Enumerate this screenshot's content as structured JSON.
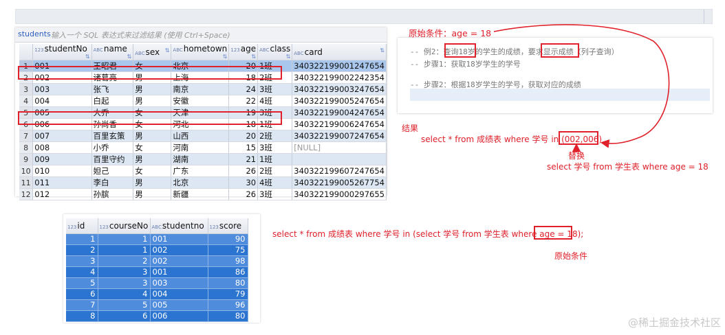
{
  "students_panel": {
    "tab": "students",
    "filter_placeholder": "输入一个 SQL 表达式来过滤结果 (使用 Ctrl+Space)",
    "columns": [
      "studentNo",
      "name",
      "sex",
      "hometown",
      "age",
      "class",
      "card"
    ],
    "rows": [
      [
        "1",
        "001",
        "王昭君",
        "女",
        "北京",
        "20",
        "1班",
        "340322199001247654"
      ],
      [
        "2",
        "002",
        "诸葛亮",
        "男",
        "上海",
        "18",
        "2班",
        "340322199002242354"
      ],
      [
        "3",
        "003",
        "张飞",
        "男",
        "南京",
        "24",
        "3班",
        "340322199003247654"
      ],
      [
        "4",
        "004",
        "白起",
        "男",
        "安徽",
        "22",
        "4班",
        "340322199005247654"
      ],
      [
        "5",
        "005",
        "大乔",
        "女",
        "天津",
        "19",
        "3班",
        "340322199004247654"
      ],
      [
        "6",
        "006",
        "孙尚香",
        "女",
        "河北",
        "18",
        "1班",
        "340322199006247654"
      ],
      [
        "7",
        "007",
        "百里玄策",
        "男",
        "山西",
        "20",
        "2班",
        "340322199007247654"
      ],
      [
        "8",
        "008",
        "小乔",
        "女",
        "河南",
        "15",
        "3班",
        "[NULL]"
      ],
      [
        "9",
        "009",
        "百里守约",
        "男",
        "湖南",
        "21",
        "1班",
        ""
      ],
      [
        "10",
        "010",
        "妲己",
        "女",
        "广东",
        "26",
        "2班",
        "340322199607247654"
      ],
      [
        "11",
        "011",
        "李白",
        "男",
        "北京",
        "30",
        "4班",
        "340322199005267754"
      ],
      [
        "12",
        "012",
        "孙膑",
        "男",
        "新疆",
        "26",
        "3班",
        "340322199000297655"
      ]
    ]
  },
  "comment_panel": {
    "lines": [
      "-- 例2：查询18岁的学生的成绩，要求显示成绩（列子查询）",
      "-- 步骤1：获取18岁学生的学号",
      "-- 步骤2：根据18岁学生的学号，获取对应的成绩"
    ]
  },
  "annotations": {
    "original_condition_top": "原始条件：age = 18",
    "result_label": "结果",
    "result_sql": "select * from 成绩表 where 学号 in (002,006)",
    "replace_label": "替换",
    "subquery_sql": "select 学号 from 学生表 where age = 18",
    "full_sql": "select * from 成绩表 where 学号 in (select 学号 from 学生表 where age = 18);",
    "original_condition_bottom": "原始条件"
  },
  "scores_panel": {
    "columns": [
      "id",
      "courseNo",
      "studentno",
      "score"
    ],
    "rows": [
      [
        "1",
        "1",
        "001",
        "90"
      ],
      [
        "2",
        "1",
        "002",
        "75"
      ],
      [
        "3",
        "2",
        "002",
        "98"
      ],
      [
        "4",
        "3",
        "001",
        "86"
      ],
      [
        "5",
        "3",
        "003",
        "80"
      ],
      [
        "6",
        "4",
        "004",
        "79"
      ],
      [
        "7",
        "5",
        "005",
        "96"
      ],
      [
        "8",
        "6",
        "006",
        "80"
      ]
    ]
  },
  "watermark": "@稀土掘金技术社区",
  "colors": {
    "annotation_red": "#e0202a",
    "selection_blue": "#2b74cf",
    "header_bg": "#e2e6ed"
  }
}
